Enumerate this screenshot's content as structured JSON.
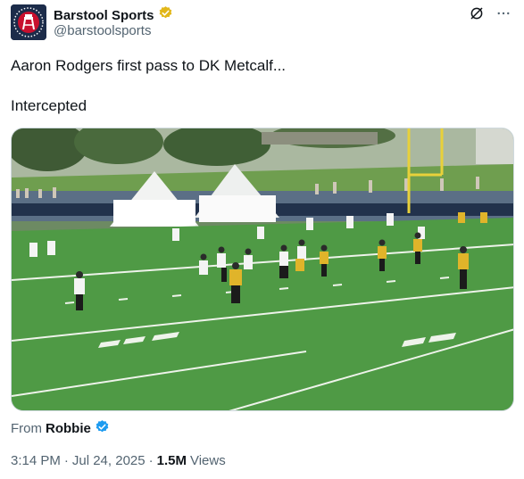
{
  "author": {
    "display_name": "Barstool Sports",
    "handle": "@barstoolsports",
    "avatar_letter": "B"
  },
  "post": {
    "line1": "Aaron Rodgers first pass to DK Metcalf...",
    "line2": "Intercepted"
  },
  "attribution": {
    "prefix": "From",
    "name": "Robbie"
  },
  "meta": {
    "time": "3:14 PM",
    "sep1": "·",
    "date": "Jul 24, 2025",
    "sep2": "·",
    "views_count": "1.5M",
    "views_label": "Views"
  },
  "icons": {
    "verified": "verified-badge-icon",
    "grok": "grok-icon",
    "more": "more-icon"
  },
  "colors": {
    "verified_gold": "#e2b719",
    "verified_blue": "#1d9bf0",
    "field_green": "#4f9a45"
  }
}
